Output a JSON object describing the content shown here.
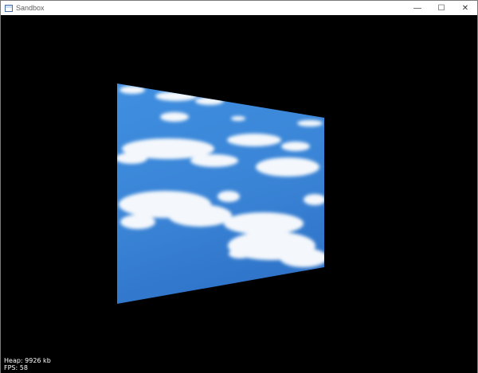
{
  "window": {
    "title": "Sandbox",
    "controls": {
      "minimize": "—",
      "maximize": "☐",
      "close": "✕"
    }
  },
  "hud": {
    "heap": "Heap: 9926 kb",
    "fps": "FPS: 58"
  },
  "scene": {
    "texture": "sky-with-clouds",
    "sky_color": "#3a86d8",
    "background_color": "#000000"
  }
}
